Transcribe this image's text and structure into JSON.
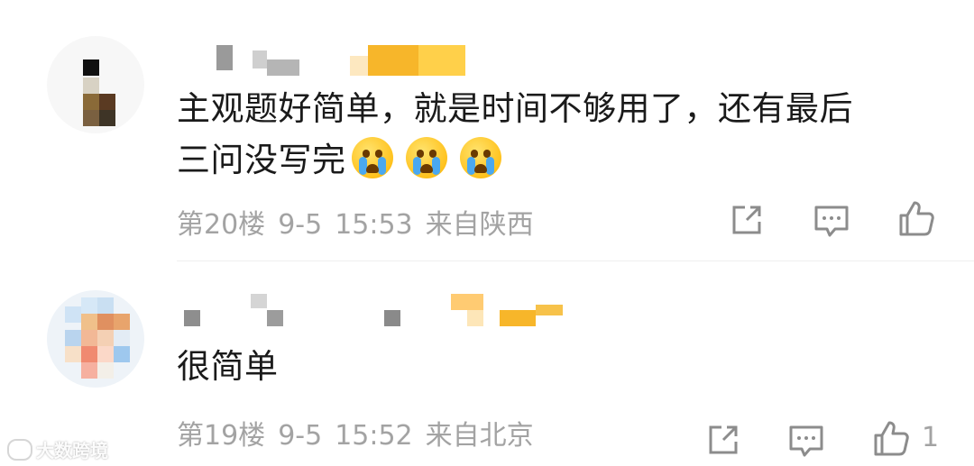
{
  "comments": [
    {
      "text_line1": "主观题好简单，就是时间不够用了，还有最后",
      "text_line2": "三问没写完",
      "emoji_count": 3,
      "emoji_icon": "loudly-crying-face",
      "floor": "第20楼",
      "date": "9-5",
      "time": "15:53",
      "location": "来自陕西",
      "like_count": ""
    },
    {
      "text_line1": "很简单",
      "text_line2": "",
      "emoji_count": 0,
      "floor": "第19楼",
      "date": "9-5",
      "time": "15:52",
      "location": "来自北京",
      "like_count": "1"
    }
  ],
  "action_icons": [
    "share-icon",
    "comment-icon",
    "like-icon"
  ],
  "watermark": {
    "text": "大数跨境",
    "icon": "bubble-logo-icon"
  },
  "colors": {
    "text_primary": "#1a1a1a",
    "text_secondary": "#a3a3a3",
    "icon": "#8c8c8c",
    "username_blur_orange": "#f7b62a",
    "background": "#ffffff"
  }
}
